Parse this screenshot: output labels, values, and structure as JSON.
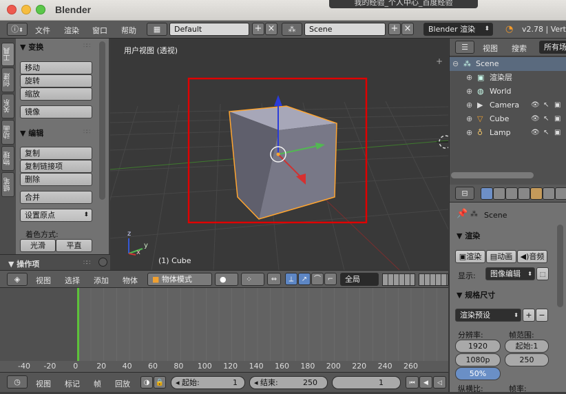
{
  "window": {
    "title": "Blender",
    "overlay_tab": "我的经验_个人中心_百度经验"
  },
  "infobar": {
    "menus": [
      "文件",
      "渲染",
      "窗口",
      "帮助"
    ],
    "screen": "Default",
    "scene": "Scene",
    "engine": "Blender 渲染",
    "version": "v2.78 | Vert"
  },
  "left_tabs": [
    "工具",
    "创建",
    "关系",
    "动画",
    "物理",
    "蜡笔"
  ],
  "tool_panel": {
    "transform_header": "变换",
    "transform_buttons": [
      "移动",
      "旋转",
      "缩放"
    ],
    "mirror": "镜像",
    "edit_header": "编辑",
    "edit_buttons": [
      "复制",
      "复制链接项",
      "删除"
    ],
    "join": "合并",
    "set_origin": "设置原点",
    "shading_label": "着色方式:",
    "smooth": "光滑",
    "flat": "平直",
    "operator_header": "操作项"
  },
  "viewport": {
    "title": "用户视图 (透视)",
    "object_label": "(1) Cube",
    "axis_z": "z",
    "axis_y": "y",
    "axis_x": "x"
  },
  "viewport_header": {
    "menus": [
      "视图",
      "选择",
      "添加",
      "物体"
    ],
    "mode": "物体模式",
    "pivot_scope": "全局"
  },
  "timeline": {
    "ruler": [
      "-40",
      "-20",
      "0",
      "20",
      "40",
      "60",
      "80",
      "100",
      "120",
      "140",
      "160",
      "180",
      "200",
      "220",
      "240",
      "260"
    ],
    "menus": [
      "视图",
      "标记",
      "帧",
      "回放"
    ],
    "start_label": "起始:",
    "start_value": "1",
    "end_label": "结束:",
    "end_value": "250",
    "current_frame": "1"
  },
  "outliner": {
    "menus": [
      "视图",
      "搜索"
    ],
    "filter": "所有场",
    "items": [
      {
        "label": "Scene",
        "icon": "scene-icon",
        "level": 0
      },
      {
        "label": "渲染层",
        "icon": "render-layers-icon",
        "level": 1
      },
      {
        "label": "World",
        "icon": "world-icon",
        "level": 1
      },
      {
        "label": "Camera",
        "icon": "camera-icon",
        "level": 1
      },
      {
        "label": "Cube",
        "icon": "mesh-icon",
        "level": 1
      },
      {
        "label": "Lamp",
        "icon": "lamp-icon",
        "level": 1
      }
    ]
  },
  "properties": {
    "scene": "Scene",
    "render_header": "渲染",
    "render_buttons": [
      "渲染",
      "动画",
      "音频"
    ],
    "display_label": "显示:",
    "display_value": "图像编辑",
    "dimensions_header": "规格尺寸",
    "preset": "渲染预设",
    "resolution_label": "分辨率:",
    "frame_range_label": "帧范围:",
    "start_field": "起始:1",
    "field_a": "1920",
    "field_b": "250",
    "field_c": "1080p",
    "field_d": "50%",
    "aspect_label": "纵横比:",
    "fps_label": "帧率:"
  },
  "colors": {
    "selection_box": "#e00000",
    "cube_outline": "#ffa530",
    "x_axis": "#cc3333",
    "y_axis": "#52b852"
  }
}
